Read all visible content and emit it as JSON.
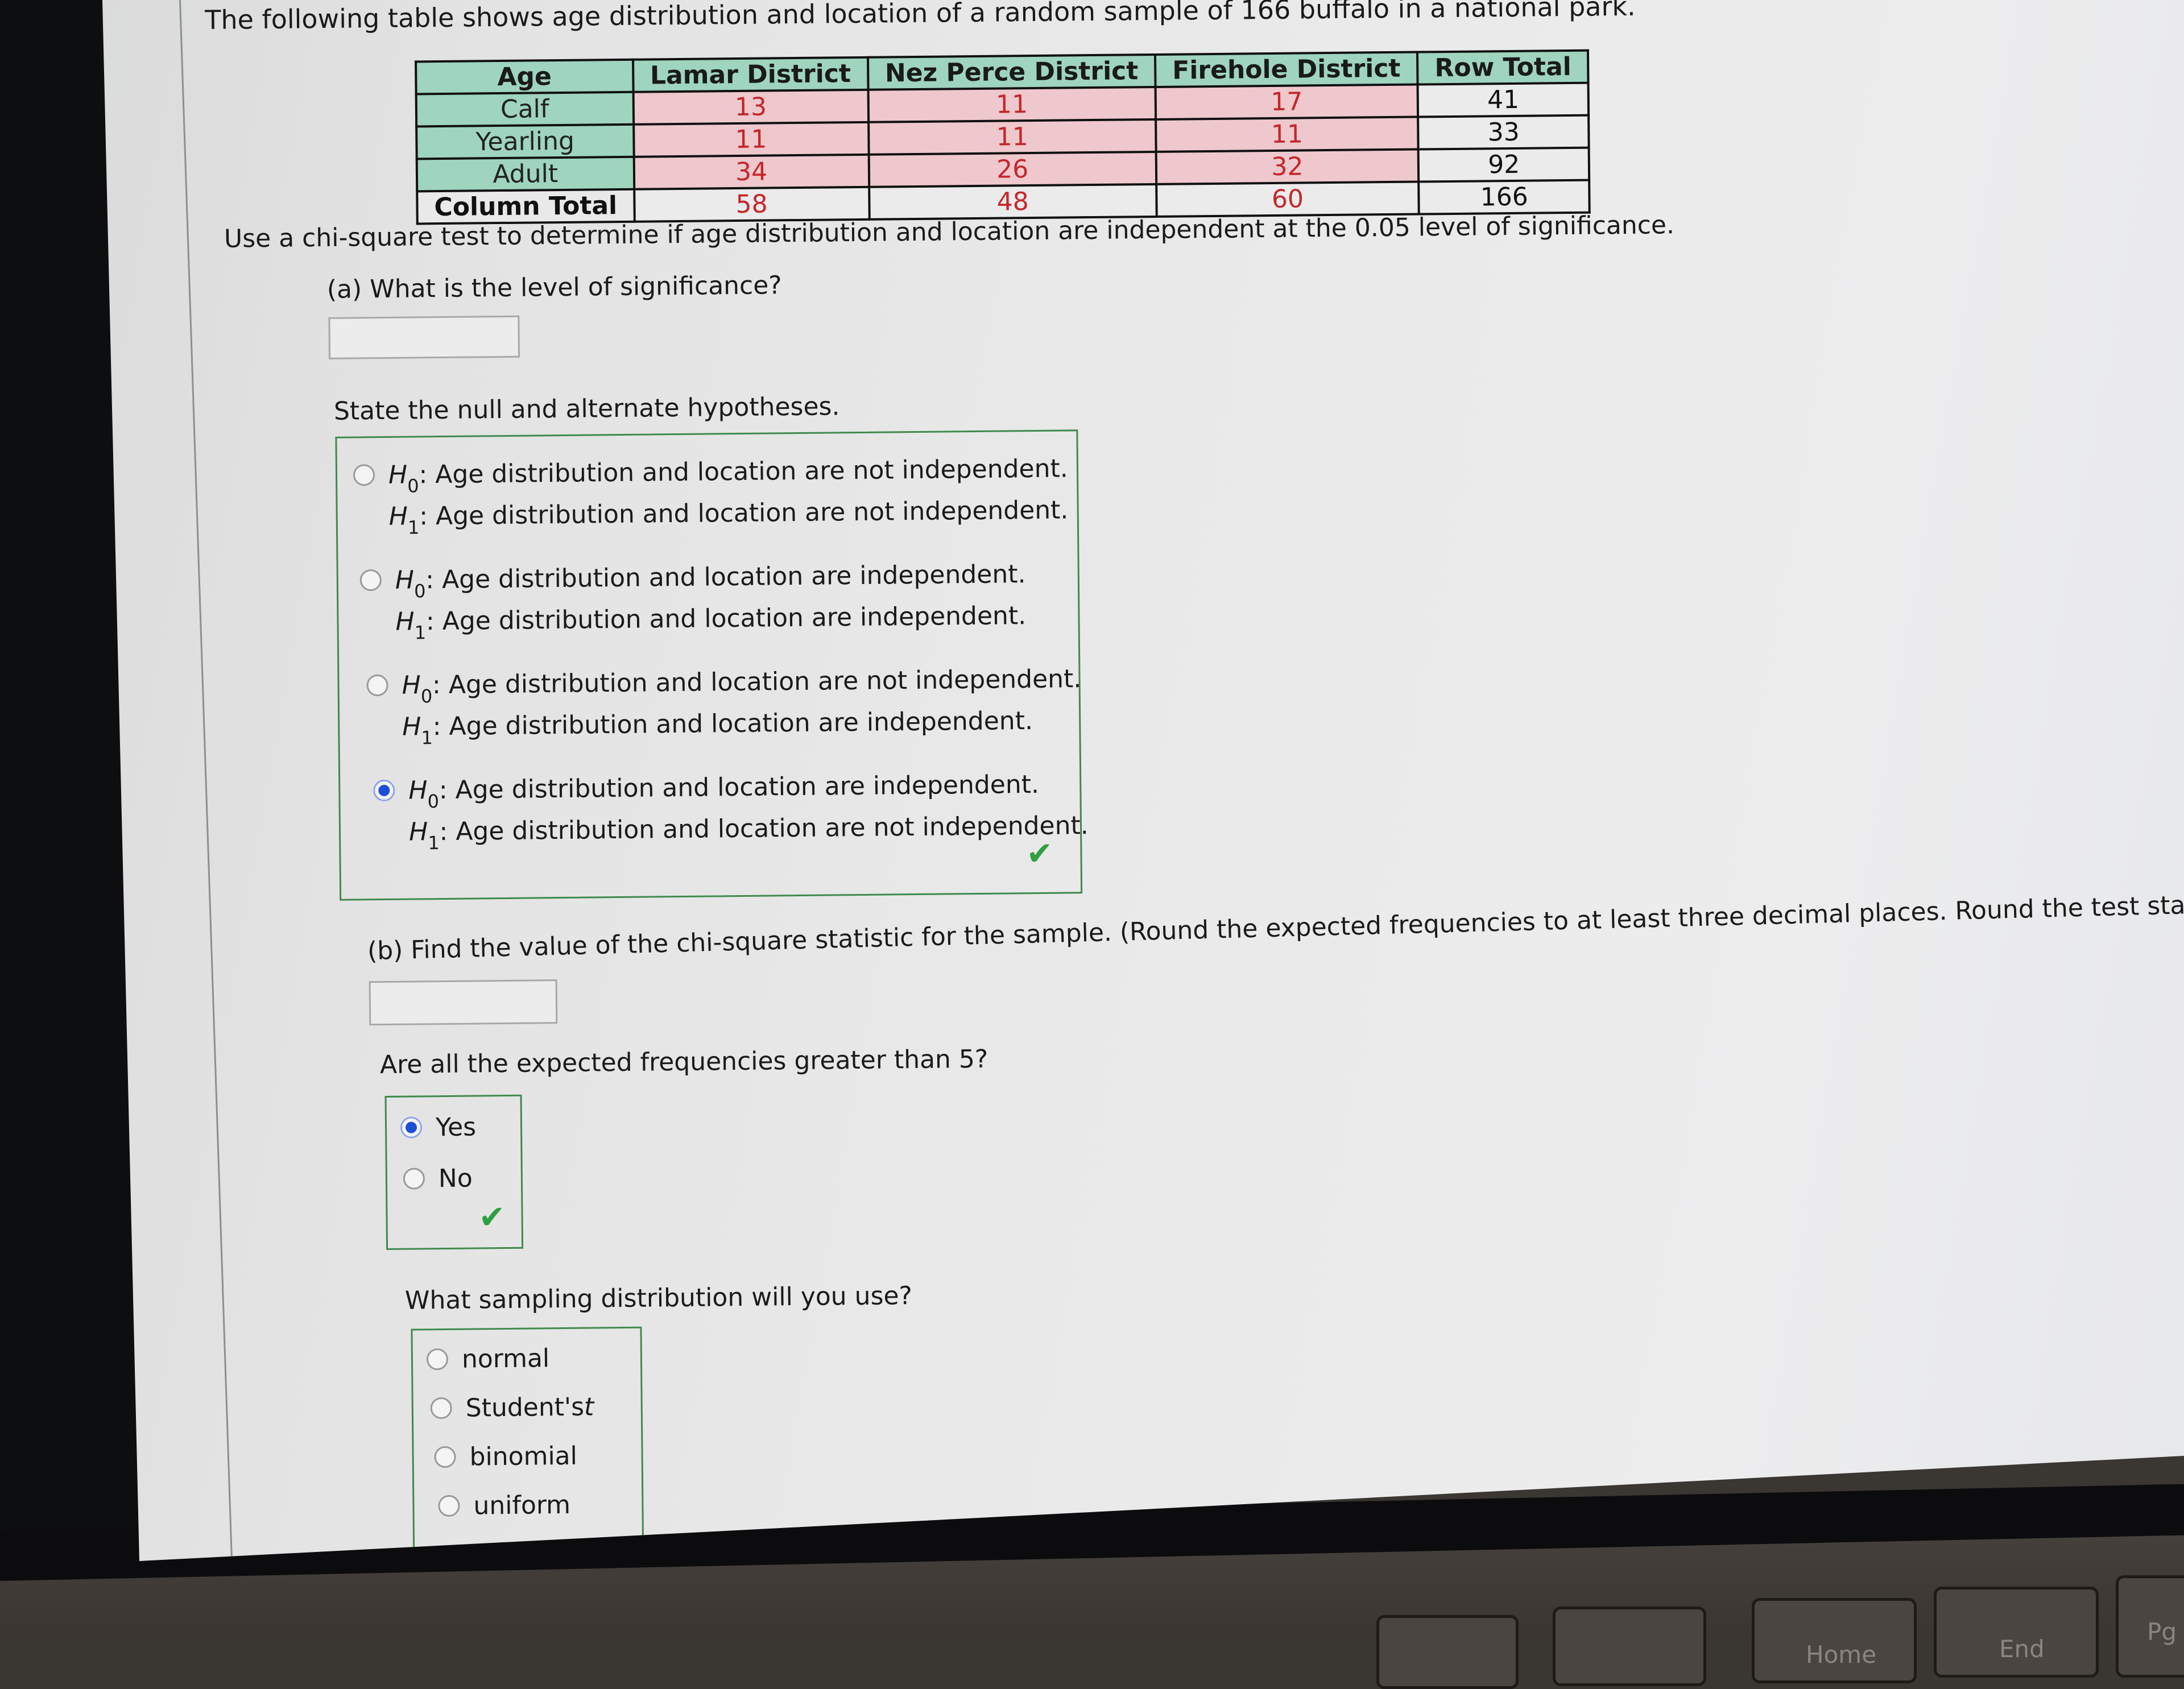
{
  "problem": {
    "intro": "The following table shows age distribution and location of a random sample of 166 buffalo in a national park.",
    "table": {
      "headers": [
        "Age",
        "Lamar District",
        "Nez Perce District",
        "Firehole District",
        "Row Total"
      ],
      "rows": [
        {
          "label": "Calf",
          "values": [
            "13",
            "11",
            "17"
          ],
          "total": "41"
        },
        {
          "label": "Yearling",
          "values": [
            "11",
            "11",
            "11"
          ],
          "total": "33"
        },
        {
          "label": "Adult",
          "values": [
            "34",
            "26",
            "32"
          ],
          "total": "92"
        }
      ],
      "column_total": {
        "label": "Column Total",
        "values": [
          "58",
          "48",
          "60"
        ],
        "total": "166"
      }
    },
    "instruction": "Use a chi-square test to determine if age distribution and location are independent at the 0.05 level of significance."
  },
  "part_a": {
    "question": "(a) What is the level of significance?",
    "answer_value": ""
  },
  "hypotheses": {
    "prompt": "State the null and alternate hypotheses.",
    "h0_symbol": "H",
    "h0_sub": "0",
    "h1_symbol": "H",
    "h1_sub": "1",
    "options": [
      {
        "h0": ": Age distribution and location are not independent.",
        "h1": ": Age distribution and location are not independent.",
        "selected": false
      },
      {
        "h0": ": Age distribution and location are independent.",
        "h1": ": Age distribution and location are independent.",
        "selected": false
      },
      {
        "h0": ": Age distribution and location are not independent.",
        "h1": ": Age distribution and location are independent.",
        "selected": false
      },
      {
        "h0": ": Age distribution and location are independent.",
        "h1": ": Age distribution and location are not independent.",
        "selected": true
      }
    ],
    "status": "correct"
  },
  "part_b": {
    "question": "(b) Find the value of the chi-square statistic for the sample. (Round the expected frequencies to at least three decimal places. Round the test statistic to three",
    "answer_value": ""
  },
  "expected_freq": {
    "question": "Are all the expected frequencies greater than 5?",
    "options": [
      {
        "label": "Yes",
        "selected": true
      },
      {
        "label": "No",
        "selected": false
      }
    ],
    "status": "correct"
  },
  "sampling_dist": {
    "question": "What sampling distribution will you use?",
    "options": [
      {
        "label": "normal",
        "selected": false
      },
      {
        "label": "Student's ",
        "italic_suffix": "t",
        "selected": false
      },
      {
        "label": "binomial",
        "selected": false
      },
      {
        "label": "uniform",
        "selected": false
      }
    ]
  },
  "keyboard": {
    "keys": [
      "Home",
      "End",
      "Pg"
    ]
  },
  "colors": {
    "header_bg": "#9fd4bf",
    "observed_bg": "#eec8cc",
    "observed_text": "#c4262b",
    "radio_selected": "#1d4fd6",
    "check": "#2ea043",
    "box_border": "#3f8a4e"
  }
}
